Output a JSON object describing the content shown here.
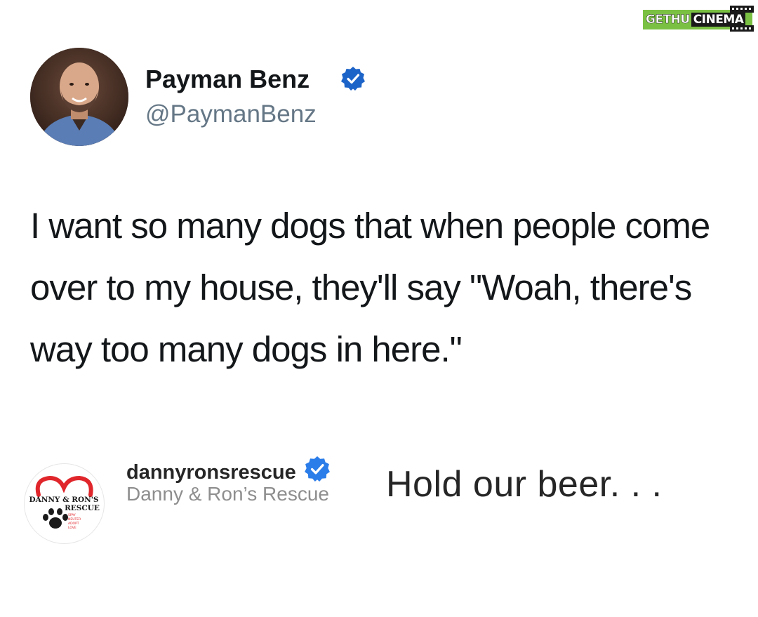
{
  "watermark": {
    "part_a": "GETHU",
    "part_b": "CINEMA"
  },
  "tweet": {
    "author_name": "Payman Benz",
    "author_handle": "@PaymanBenz",
    "text": "I want so many dogs that when people come over to my house, they'll say \"Woah, there's way too many dogs in here.\""
  },
  "reply": {
    "username": "dannyronsrescue",
    "display_name": "Danny & Ron’s Rescue",
    "comment": "Hold our beer. . .",
    "logo_text": {
      "line1": "DANNY & RON'S",
      "line2": "RESCUE",
      "tagline": [
        "SPAY",
        "NEUTER",
        "ADOPT",
        "LOVE"
      ]
    }
  },
  "colors": {
    "verified_blue": "#1da1f2",
    "handle_grey": "#657786",
    "logo_red": "#e0262b",
    "watermark_green": "#7ac143"
  },
  "icons": {
    "verified": "verified-badge-icon",
    "paw": "paw-print-icon",
    "heart": "heart-icon",
    "film": "film-strip-icon"
  }
}
